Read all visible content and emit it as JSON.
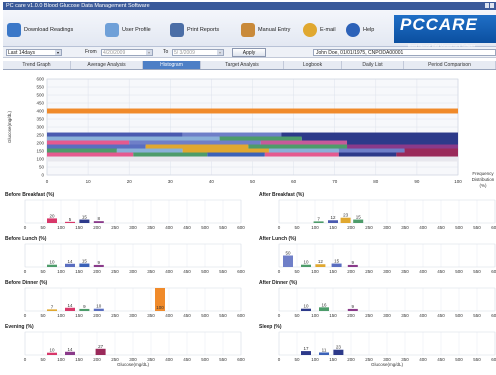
{
  "window": {
    "title": "PC care v1.0.0 Blood Glucose Data Management Software"
  },
  "toolbar": {
    "buttons": [
      {
        "label": "Download Readings",
        "icon": "download-icon",
        "color": "#3b78c8"
      },
      {
        "label": "User Profile",
        "icon": "user-profile-icon",
        "color": "#6fa0d8"
      },
      {
        "label": "Print Reports",
        "icon": "printer-icon",
        "color": "#4b6ea6"
      },
      {
        "label": "Manual Entry",
        "icon": "manual-entry-icon",
        "color": "#c98a3a"
      },
      {
        "label": "E-mail",
        "icon": "email-icon",
        "color": "#e0a830"
      },
      {
        "label": "Help",
        "icon": "help-icon",
        "color": "#2d62b8"
      }
    ],
    "logo_text": "PCCARE",
    "logo_subtitle": "Blood Glucose Data Management Software"
  },
  "filter": {
    "period": "Last 14days",
    "from_label": "From",
    "from_value": "4/20/2009",
    "to_label": "To",
    "to_value": "5/ 3/2009",
    "apply_label": "Apply",
    "patient": "John Doe,  01/01/1975,  CNPODA00001"
  },
  "tabs": [
    "Trend Graph",
    "Average Analysis",
    "Histogram",
    "Target Analysis",
    "Logbook",
    "Daily List",
    "Period Comparison"
  ],
  "active_tab": "Histogram",
  "chart_data": [
    {
      "type": "bar",
      "title": "",
      "ylabel": "Glucose(mg/dL)",
      "xlabel": "Frequency Distribution (%)",
      "xlim": [
        0,
        100
      ],
      "ylim": [
        0,
        600
      ],
      "xticks": [
        0,
        10,
        20,
        30,
        40,
        50,
        60,
        70,
        80,
        90,
        100
      ],
      "yticks": [
        0,
        50,
        100,
        150,
        200,
        250,
        300,
        350,
        400,
        450,
        500,
        550,
        600
      ],
      "series": [
        {
          "y": 400,
          "segments": [
            {
              "start": 0,
              "end": 100,
              "color": "#f08a2a"
            }
          ]
        },
        {
          "y": 250,
          "segments": [
            {
              "start": 0,
              "end": 33,
              "color": "#4a5ab0"
            },
            {
              "start": 33,
              "end": 57,
              "color": "#6f7fc8"
            },
            {
              "start": 57,
              "end": 100,
              "color": "#2d3a8a"
            }
          ]
        },
        {
          "y": 225,
          "segments": [
            {
              "start": 0,
              "end": 42,
              "color": "#8ab0d8"
            },
            {
              "start": 42,
              "end": 62,
              "color": "#4d9c6a"
            },
            {
              "start": 62,
              "end": 100,
              "color": "#2d3a8a"
            }
          ]
        },
        {
          "y": 200,
          "segments": [
            {
              "start": 0,
              "end": 20,
              "color": "#e55a8f"
            },
            {
              "start": 20,
              "end": 52,
              "color": "#6f7fc8"
            },
            {
              "start": 52,
              "end": 73,
              "color": "#c65a9a"
            },
            {
              "start": 73,
              "end": 100,
              "color": "#2d3a8a"
            }
          ]
        },
        {
          "y": 175,
          "segments": [
            {
              "start": 0,
              "end": 24,
              "color": "#5a6ec0"
            },
            {
              "start": 24,
              "end": 49,
              "color": "#e0a830"
            },
            {
              "start": 49,
              "end": 73,
              "color": "#4d9c6a"
            },
            {
              "start": 73,
              "end": 100,
              "color": "#8a3a8a"
            }
          ]
        },
        {
          "y": 150,
          "segments": [
            {
              "start": 0,
              "end": 17,
              "color": "#4d9c6a"
            },
            {
              "start": 17,
              "end": 33,
              "color": "#8ab0d8"
            },
            {
              "start": 33,
              "end": 54,
              "color": "#e0a830"
            },
            {
              "start": 54,
              "end": 71,
              "color": "#8ab0d8"
            },
            {
              "start": 71,
              "end": 87,
              "color": "#6f7fc8"
            },
            {
              "start": 87,
              "end": 100,
              "color": "#9a2a5a"
            }
          ]
        },
        {
          "y": 125,
          "segments": [
            {
              "start": 0,
              "end": 21,
              "color": "#e55a8f"
            },
            {
              "start": 21,
              "end": 39,
              "color": "#4d9c6a"
            },
            {
              "start": 39,
              "end": 53,
              "color": "#3b62b8"
            },
            {
              "start": 53,
              "end": 71,
              "color": "#e55a8f"
            },
            {
              "start": 71,
              "end": 85,
              "color": "#2d3a8a"
            },
            {
              "start": 85,
              "end": 100,
              "color": "#9a2a5a"
            }
          ]
        },
        {
          "y": 100,
          "segments": [
            {
              "start": 0,
              "end": 100,
              "color": "#e8e8ee"
            }
          ]
        }
      ]
    },
    {
      "type": "bar",
      "title": "Before Breakfast (%)",
      "xlim": [
        0,
        600
      ],
      "bars": [
        {
          "x": 75,
          "value": 20,
          "color": "#d8386a"
        },
        {
          "x": 125,
          "value": 5,
          "color": "#d8386a"
        },
        {
          "x": 165,
          "value": 15,
          "color": "#2d3a8a"
        },
        {
          "x": 205,
          "value": 8,
          "color": "#8a3a8a"
        }
      ]
    },
    {
      "type": "bar",
      "title": "After Breakfast (%)",
      "xlim": [
        0,
        600
      ],
      "bars": [
        {
          "x": 110,
          "value": 7,
          "color": "#4d9c6a"
        },
        {
          "x": 150,
          "value": 12,
          "color": "#4a5ab0"
        },
        {
          "x": 185,
          "value": 23,
          "color": "#e0a830"
        },
        {
          "x": 220,
          "value": 15,
          "color": "#4d9c6a"
        }
      ]
    },
    {
      "type": "bar",
      "title": "Before Lunch (%)",
      "xlim": [
        0,
        600
      ],
      "bars": [
        {
          "x": 75,
          "value": 10,
          "color": "#4d9c6a"
        },
        {
          "x": 125,
          "value": 14,
          "color": "#5a6ec0"
        },
        {
          "x": 165,
          "value": 15,
          "color": "#3b62b8"
        },
        {
          "x": 205,
          "value": 9,
          "color": "#8a3a8a"
        }
      ]
    },
    {
      "type": "bar",
      "title": "After Lunch (%)",
      "xlim": [
        0,
        600
      ],
      "bars": [
        {
          "x": 25,
          "value": 50,
          "color": "#6f7fc8"
        },
        {
          "x": 75,
          "value": 10,
          "color": "#4d9c6a"
        },
        {
          "x": 115,
          "value": 12,
          "color": "#e0a830"
        },
        {
          "x": 160,
          "value": 15,
          "color": "#5a6ec0"
        },
        {
          "x": 205,
          "value": 9,
          "color": "#8a3a8a"
        }
      ]
    },
    {
      "type": "bar",
      "title": "Before Dinner (%)",
      "xlim": [
        0,
        600
      ],
      "bars": [
        {
          "x": 75,
          "value": 7,
          "color": "#e0a830"
        },
        {
          "x": 125,
          "value": 14,
          "color": "#d8386a"
        },
        {
          "x": 165,
          "value": 9,
          "color": "#4d9c6a"
        },
        {
          "x": 205,
          "value": 10,
          "color": "#5a6ec0"
        },
        {
          "x": 375,
          "value": 100,
          "color": "#f08a2a"
        }
      ]
    },
    {
      "type": "bar",
      "title": "After Dinner (%)",
      "xlim": [
        0,
        600
      ],
      "bars": [
        {
          "x": 75,
          "value": 10,
          "color": "#2d3a8a"
        },
        {
          "x": 125,
          "value": 16,
          "color": "#4d9c6a"
        },
        {
          "x": 205,
          "value": 9,
          "color": "#8a3a8a"
        }
      ]
    },
    {
      "type": "bar",
      "title": "Evening (%)",
      "xlim": [
        0,
        600
      ],
      "xlabel": "Glucose(mg/dL)",
      "bars": [
        {
          "x": 75,
          "value": 10,
          "color": "#d8386a"
        },
        {
          "x": 125,
          "value": 14,
          "color": "#8a3a8a"
        },
        {
          "x": 210,
          "value": 27,
          "color": "#9a2a5a"
        }
      ]
    },
    {
      "type": "bar",
      "title": "Sleep (%)",
      "xlim": [
        0,
        600
      ],
      "xlabel": "Glucose(mg/dL)",
      "bars": [
        {
          "x": 75,
          "value": 17,
          "color": "#2d3a8a"
        },
        {
          "x": 125,
          "value": 11,
          "color": "#3b62b8"
        },
        {
          "x": 165,
          "value": 23,
          "color": "#2d3a8a"
        }
      ]
    }
  ]
}
